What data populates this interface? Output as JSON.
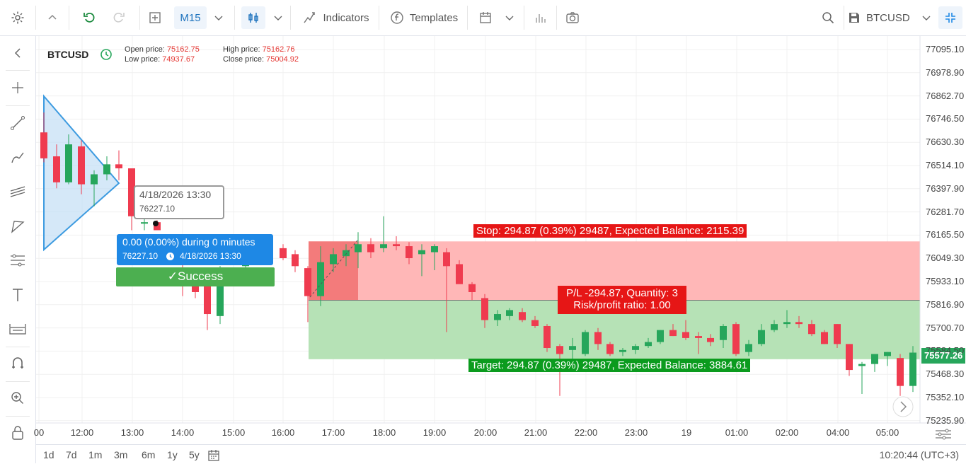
{
  "toolbar": {
    "timeframe": "M15",
    "indicators_label": "Indicators",
    "templates_label": "Templates",
    "symbol": "BTCUSD"
  },
  "legend": {
    "symbol": "BTCUSD",
    "open_label": "Open price:",
    "open_value": "75162.75",
    "low_label": "Low price:",
    "low_value": "74937.67",
    "high_label": "High price:",
    "high_value": "75162.76",
    "close_label": "Close price:",
    "close_value": "75004.92"
  },
  "tooltip": {
    "date": "4/18/2026 13:30",
    "price": "76227.10"
  },
  "measure": {
    "line1": "0.00 (0.00%) during 0 minutes",
    "price": "76227.10",
    "date": "4/18/2026 13:30",
    "success": "✓Success"
  },
  "position": {
    "stop_label": "Stop: 294.87 (0.39%) 29487, Expected Balance: 2115.39",
    "pl_label": "P/L -294.87, Quantity: 3",
    "ratio_label": "Risk/profit ratio: 1.00",
    "target_label": "Target: 294.87 (0.39%) 29487, Expected Balance: 3884.61",
    "stop_price": 76134,
    "entry_price": 75839,
    "target_price": 75544
  },
  "price_axis": {
    "labels": [
      "77095.10",
      "76978.90",
      "76862.70",
      "76746.50",
      "76630.30",
      "76514.10",
      "76397.90",
      "76281.70",
      "76165.50",
      "76049.30",
      "75933.10",
      "75816.90",
      "75700.70",
      "75584.50",
      "75468.30",
      "75352.10",
      "75235.90"
    ],
    "current_price": "75577.26"
  },
  "time_axis": {
    "labels": [
      "00",
      "12:00",
      "13:00",
      "14:00",
      "15:00",
      "16:00",
      "17:00",
      "18:00",
      "19:00",
      "20:00",
      "21:00",
      "22:00",
      "23:00",
      "19",
      "01:00",
      "02:00",
      "04:00",
      "05:00"
    ]
  },
  "ranges": [
    "1d",
    "7d",
    "1m",
    "3m",
    "6m",
    "1y",
    "5y"
  ],
  "clock": "10:20:44 (UTC+3)",
  "colors": {
    "up": "#26a65b",
    "down": "#ef3b4f",
    "stop_zone": "#ffb3b3",
    "target_zone": "#b2e0b2",
    "accent": "#1e88e5"
  },
  "chart_data": {
    "type": "candlestick",
    "candles": [
      {
        "t": "11:45",
        "o": 76680,
        "h": 76780,
        "l": 76530,
        "c": 76550
      },
      {
        "t": "11:52",
        "o": 76560,
        "h": 76620,
        "l": 76400,
        "c": 76430
      },
      {
        "t": "12:00",
        "o": 76430,
        "h": 76670,
        "l": 76420,
        "c": 76620
      },
      {
        "t": "12:07",
        "o": 76610,
        "h": 76640,
        "l": 76370,
        "c": 76420
      },
      {
        "t": "12:15",
        "o": 76420,
        "h": 76490,
        "l": 76310,
        "c": 76470
      },
      {
        "t": "12:22",
        "o": 76470,
        "h": 76560,
        "l": 76440,
        "c": 76520
      },
      {
        "t": "12:30",
        "o": 76520,
        "h": 76590,
        "l": 76440,
        "c": 76500
      },
      {
        "t": "13:00",
        "o": 76500,
        "h": 76500,
        "l": 76190,
        "c": 76260
      },
      {
        "t": "13:07",
        "o": 76230,
        "h": 76270,
        "l": 76190,
        "c": 76230
      },
      {
        "t": "13:30",
        "o": 76230,
        "h": 76240,
        "l": 76190,
        "c": 76190
      },
      {
        "t": "14:00",
        "o": 75950,
        "h": 76050,
        "l": 75860,
        "c": 75910
      },
      {
        "t": "14:07",
        "o": 75910,
        "h": 75960,
        "l": 75850,
        "c": 75880
      },
      {
        "t": "14:22",
        "o": 75930,
        "h": 75930,
        "l": 75690,
        "c": 75770
      },
      {
        "t": "14:37",
        "o": 75760,
        "h": 76010,
        "l": 75720,
        "c": 75980
      },
      {
        "t": "15:00",
        "o": 76010,
        "h": 76160,
        "l": 75990,
        "c": 76130
      },
      {
        "t": "16:00",
        "o": 76100,
        "h": 76120,
        "l": 76040,
        "c": 76050
      },
      {
        "t": "16:07",
        "o": 76070,
        "h": 76090,
        "l": 75980,
        "c": 76010
      },
      {
        "t": "16:30",
        "o": 76000,
        "h": 76010,
        "l": 75730,
        "c": 75860
      },
      {
        "t": "16:45",
        "o": 75860,
        "h": 76110,
        "l": 75810,
        "c": 76030
      },
      {
        "t": "17:00",
        "o": 76020,
        "h": 76100,
        "l": 75980,
        "c": 76070
      },
      {
        "t": "17:15",
        "o": 76060,
        "h": 76120,
        "l": 76010,
        "c": 76090
      },
      {
        "t": "17:30",
        "o": 76080,
        "h": 76180,
        "l": 76000,
        "c": 76120
      },
      {
        "t": "17:45",
        "o": 76120,
        "h": 76150,
        "l": 76050,
        "c": 76080
      },
      {
        "t": "18:00",
        "o": 76100,
        "h": 76260,
        "l": 76080,
        "c": 76120
      },
      {
        "t": "18:15",
        "o": 76120,
        "h": 76160,
        "l": 76090,
        "c": 76110
      },
      {
        "t": "18:30",
        "o": 76110,
        "h": 76130,
        "l": 76020,
        "c": 76050
      },
      {
        "t": "18:45",
        "o": 76070,
        "h": 76120,
        "l": 75960,
        "c": 76090
      },
      {
        "t": "19:00",
        "o": 76080,
        "h": 76120,
        "l": 75990,
        "c": 76110
      },
      {
        "t": "19:15",
        "o": 76080,
        "h": 76100,
        "l": 75680,
        "c": 76010
      },
      {
        "t": "19:30",
        "o": 76020,
        "h": 76040,
        "l": 75950,
        "c": 75920
      },
      {
        "t": "19:45",
        "o": 75920,
        "h": 75930,
        "l": 75840,
        "c": 75880
      },
      {
        "t": "20:00",
        "o": 75850,
        "h": 75870,
        "l": 75700,
        "c": 75740
      },
      {
        "t": "20:15",
        "o": 75740,
        "h": 75790,
        "l": 75710,
        "c": 75770
      },
      {
        "t": "20:30",
        "o": 75760,
        "h": 75800,
        "l": 75740,
        "c": 75790
      },
      {
        "t": "20:45",
        "o": 75780,
        "h": 75800,
        "l": 75730,
        "c": 75740
      },
      {
        "t": "21:00",
        "o": 75740,
        "h": 75760,
        "l": 75700,
        "c": 75710
      },
      {
        "t": "21:15",
        "o": 75710,
        "h": 75720,
        "l": 75580,
        "c": 75600
      },
      {
        "t": "21:30",
        "o": 75610,
        "h": 75620,
        "l": 75360,
        "c": 75570
      },
      {
        "t": "21:45",
        "o": 75590,
        "h": 75650,
        "l": 75520,
        "c": 75610
      },
      {
        "t": "22:00",
        "o": 75570,
        "h": 75690,
        "l": 75560,
        "c": 75680
      },
      {
        "t": "22:15",
        "o": 75680,
        "h": 75700,
        "l": 75590,
        "c": 75620
      },
      {
        "t": "22:30",
        "o": 75620,
        "h": 75630,
        "l": 75560,
        "c": 75570
      },
      {
        "t": "22:45",
        "o": 75580,
        "h": 75600,
        "l": 75560,
        "c": 75590
      },
      {
        "t": "23:00",
        "o": 75590,
        "h": 75620,
        "l": 75570,
        "c": 75610
      },
      {
        "t": "23:15",
        "o": 75610,
        "h": 75650,
        "l": 75600,
        "c": 75630
      },
      {
        "t": "23:30",
        "o": 75630,
        "h": 75690,
        "l": 75620,
        "c": 75690
      },
      {
        "t": "23:45",
        "o": 75690,
        "h": 75720,
        "l": 75660,
        "c": 75660
      },
      {
        "t": "00:00",
        "o": 75680,
        "h": 75740,
        "l": 75640,
        "c": 75650
      },
      {
        "t": "00:15",
        "o": 75660,
        "h": 75680,
        "l": 75570,
        "c": 75650
      },
      {
        "t": "00:30",
        "o": 75650,
        "h": 75670,
        "l": 75610,
        "c": 75630
      },
      {
        "t": "00:45",
        "o": 75640,
        "h": 75720,
        "l": 75600,
        "c": 75710
      },
      {
        "t": "01:00",
        "o": 75720,
        "h": 75730,
        "l": 75560,
        "c": 75570
      },
      {
        "t": "01:15",
        "o": 75580,
        "h": 75640,
        "l": 75560,
        "c": 75620
      },
      {
        "t": "01:30",
        "o": 75620,
        "h": 75720,
        "l": 75610,
        "c": 75690
      },
      {
        "t": "01:45",
        "o": 75690,
        "h": 75740,
        "l": 75680,
        "c": 75720
      },
      {
        "t": "02:00",
        "o": 75720,
        "h": 75790,
        "l": 75700,
        "c": 75730
      },
      {
        "t": "02:15",
        "o": 75730,
        "h": 75760,
        "l": 75700,
        "c": 75720
      },
      {
        "t": "02:30",
        "o": 75720,
        "h": 75740,
        "l": 75660,
        "c": 75670
      },
      {
        "t": "02:45",
        "o": 75680,
        "h": 75690,
        "l": 75620,
        "c": 75620
      },
      {
        "t": "04:00",
        "o": 75720,
        "h": 75720,
        "l": 75600,
        "c": 75620
      },
      {
        "t": "04:15",
        "o": 75620,
        "h": 75620,
        "l": 75460,
        "c": 75490
      },
      {
        "t": "04:30",
        "o": 75510,
        "h": 75530,
        "l": 75370,
        "c": 75520
      },
      {
        "t": "04:45",
        "o": 75520,
        "h": 75560,
        "l": 75480,
        "c": 75570
      },
      {
        "t": "05:00",
        "o": 75560,
        "h": 75580,
        "l": 75510,
        "c": 75580
      },
      {
        "t": "05:15",
        "o": 75550,
        "h": 75570,
        "l": 75360,
        "c": 75410
      },
      {
        "t": "05:30",
        "o": 75410,
        "h": 75610,
        "l": 75380,
        "c": 75577
      }
    ]
  }
}
